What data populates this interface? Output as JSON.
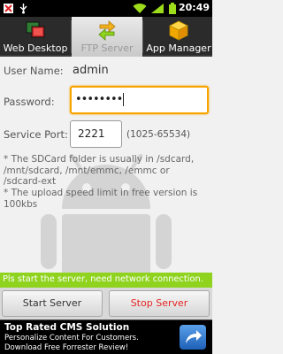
{
  "status_bar": {
    "time": "20:49",
    "icons": [
      "usb-debug-icon",
      "usb-icon",
      "wifi-icon",
      "signal-icon",
      "battery-icon"
    ]
  },
  "tabs": [
    {
      "label": "Web Desktop",
      "icon": "web-desktop-icon",
      "active": false
    },
    {
      "label": "FTP Server",
      "icon": "ftp-transfer-icon",
      "active": true
    },
    {
      "label": "App Manager",
      "icon": "box-icon",
      "active": false
    }
  ],
  "form": {
    "username_label": "User Name:",
    "username_value": "admin",
    "password_label": "Password:",
    "password_value": "••••••••",
    "port_label": "Service Port:",
    "port_value": "2221",
    "port_range": "(1025-65534)"
  },
  "notes": {
    "sdcard": "* The SDCard folder is usually in /sdcard, /mnt/sdcard, /mnt/emmc, /emmc or /sdcard-ext",
    "upload": "* The upload speed limit in free version is 100kbs"
  },
  "message": "Pls start the server, need network connection.",
  "buttons": {
    "start": "Start Server",
    "stop": "Stop Server"
  },
  "ad": {
    "title": "Top Rated CMS Solution",
    "text": "Personalize Content For Customers. Download Free Forrester Review!",
    "icon": "arrow-share-icon"
  },
  "colors": {
    "accent_focus": "#f7a400",
    "message_bar": "#8fd31f",
    "stop_text": "#e52424"
  }
}
